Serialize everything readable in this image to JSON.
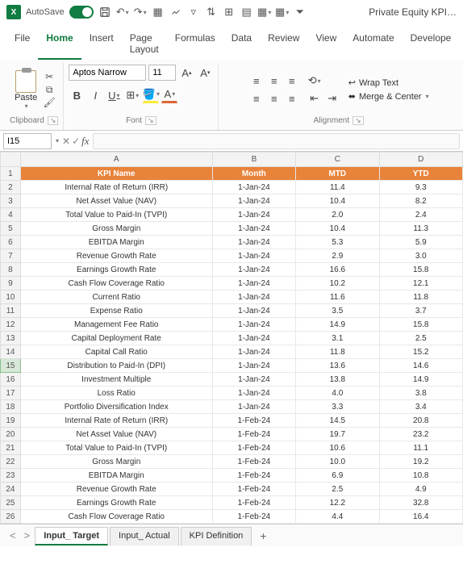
{
  "titlebar": {
    "autosave_label": "AutoSave",
    "doc_title": "Private Equity KPI…"
  },
  "menu": {
    "tabs": [
      "File",
      "Home",
      "Insert",
      "Page Layout",
      "Formulas",
      "Data",
      "Review",
      "View",
      "Automate",
      "Develope"
    ],
    "active_index": 1
  },
  "ribbon": {
    "clipboard_label": "Clipboard",
    "paste_label": "Paste",
    "font_label": "Font",
    "alignment_label": "Alignment",
    "font_name": "Aptos Narrow",
    "font_size": "11",
    "wrap_label": "Wrap Text",
    "merge_label": "Merge & Center"
  },
  "namebox": {
    "value": "I15"
  },
  "formula": {
    "value": ""
  },
  "grid": {
    "columns": [
      "A",
      "B",
      "C",
      "D"
    ],
    "header": [
      "KPI Name",
      "Month",
      "MTD",
      "YTD"
    ],
    "rows": [
      [
        "Internal Rate of Return (IRR)",
        "1-Jan-24",
        "11.4",
        "9.3"
      ],
      [
        "Net Asset Value (NAV)",
        "1-Jan-24",
        "10.4",
        "8.2"
      ],
      [
        "Total Value to Paid-In (TVPI)",
        "1-Jan-24",
        "2.0",
        "2.4"
      ],
      [
        "Gross Margin",
        "1-Jan-24",
        "10.4",
        "11.3"
      ],
      [
        "EBITDA Margin",
        "1-Jan-24",
        "5.3",
        "5.9"
      ],
      [
        "Revenue Growth Rate",
        "1-Jan-24",
        "2.9",
        "3.0"
      ],
      [
        "Earnings Growth Rate",
        "1-Jan-24",
        "16.6",
        "15.8"
      ],
      [
        "Cash Flow Coverage Ratio",
        "1-Jan-24",
        "10.2",
        "12.1"
      ],
      [
        "Current Ratio",
        "1-Jan-24",
        "11.6",
        "11.8"
      ],
      [
        "Expense Ratio",
        "1-Jan-24",
        "3.5",
        "3.7"
      ],
      [
        "Management Fee Ratio",
        "1-Jan-24",
        "14.9",
        "15.8"
      ],
      [
        "Capital Deployment Rate",
        "1-Jan-24",
        "3.1",
        "2.5"
      ],
      [
        "Capital Call Ratio",
        "1-Jan-24",
        "11.8",
        "15.2"
      ],
      [
        "Distribution to Paid-In (DPI)",
        "1-Jan-24",
        "13.6",
        "14.6"
      ],
      [
        "Investment Multiple",
        "1-Jan-24",
        "13.8",
        "14.9"
      ],
      [
        "Loss Ratio",
        "1-Jan-24",
        "4.0",
        "3.8"
      ],
      [
        "Portfolio Diversification Index",
        "1-Jan-24",
        "3.3",
        "3.4"
      ],
      [
        "Internal Rate of Return (IRR)",
        "1-Feb-24",
        "14.5",
        "20.8"
      ],
      [
        "Net Asset Value (NAV)",
        "1-Feb-24",
        "19.7",
        "23.2"
      ],
      [
        "Total Value to Paid-In (TVPI)",
        "1-Feb-24",
        "10.6",
        "11.1"
      ],
      [
        "Gross Margin",
        "1-Feb-24",
        "10.0",
        "19.2"
      ],
      [
        "EBITDA Margin",
        "1-Feb-24",
        "6.9",
        "10.8"
      ],
      [
        "Revenue Growth Rate",
        "1-Feb-24",
        "2.5",
        "4.9"
      ],
      [
        "Earnings Growth Rate",
        "1-Feb-24",
        "12.2",
        "32.8"
      ],
      [
        "Cash Flow Coverage Ratio",
        "1-Feb-24",
        "4.4",
        "16.4"
      ]
    ],
    "selected_row_index": 14
  },
  "sheets": {
    "tabs": [
      "Input_ Target",
      "Input_ Actual",
      "KPI Definition"
    ],
    "active_index": 0
  }
}
